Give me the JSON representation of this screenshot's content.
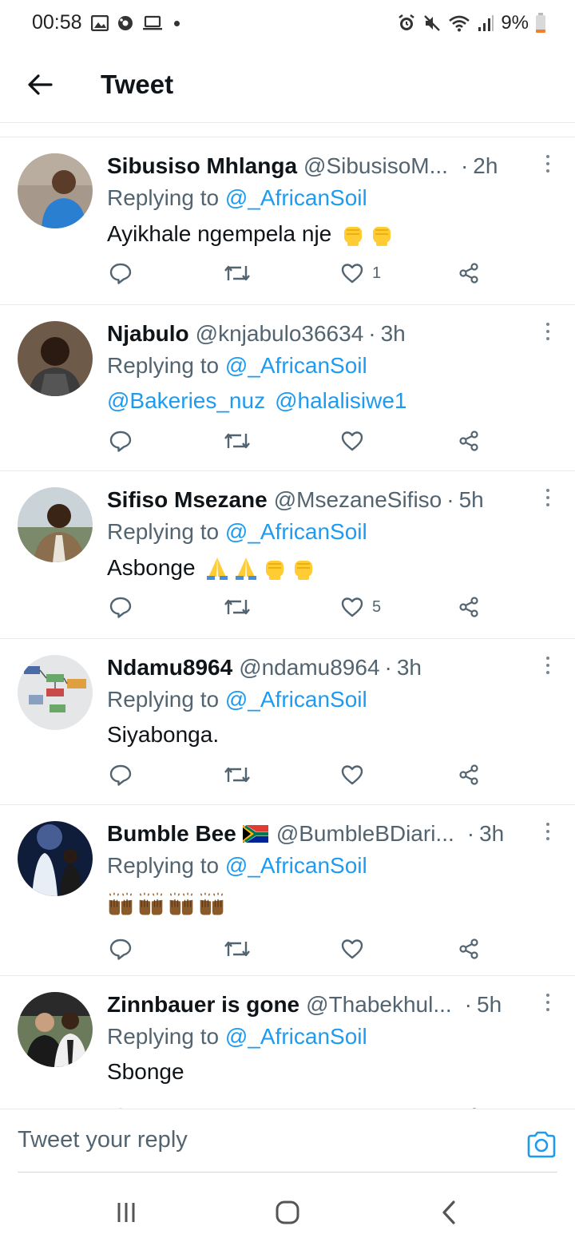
{
  "status_bar": {
    "time": "00:58",
    "battery_percent": "9%"
  },
  "header": {
    "title": "Tweet"
  },
  "replying_label": "Replying to",
  "replying_target": "@_AfricanSoil",
  "tweets": [
    {
      "name": "Sibusiso Mhlanga",
      "handle": "@SibusisoM...",
      "sep": "·",
      "time": "2h",
      "text": "Ayikhale ngempela nje",
      "emoji": [
        "raised-fist",
        "raised-fist"
      ],
      "likes": "1",
      "avatar_color": "#9c8f80"
    },
    {
      "name": "Njabulo",
      "handle": "@knjabulo36634",
      "sep": "·",
      "time": "3h",
      "mentions": [
        "@Bakeries_nuz",
        "@halalisiwe1"
      ],
      "likes": "",
      "avatar_color": "#5c4a3c"
    },
    {
      "name": "Sifiso Msezane",
      "handle": "@MsezaneSifiso",
      "sep": "·",
      "time": "5h",
      "text": "Asbonge",
      "emoji": [
        "folded-hands",
        "folded-hands",
        "raised-fist",
        "raised-fist"
      ],
      "likes": "5",
      "avatar_color": "#7a6c5b"
    },
    {
      "name": "Ndamu8964",
      "handle": "@ndamu8964",
      "sep": "·",
      "time": "3h",
      "text": "Siyabonga.",
      "likes": "",
      "avatar_color": "#c9cdd1"
    },
    {
      "name": "Bumble Bee",
      "handle": "@BumbleBDiari...",
      "sep": "·",
      "time": "3h",
      "emoji": [
        "raising-hands",
        "raising-hands",
        "raising-hands",
        "raising-hands"
      ],
      "likes": "",
      "avatar_color": "#1a2a4a"
    },
    {
      "name": "Zinnbauer is gone",
      "handle": "@Thabekhul...",
      "sep": "·",
      "time": "5h",
      "text": "Sbonge",
      "likes": "",
      "avatar_color": "#3a3a3a"
    }
  ],
  "composer": {
    "placeholder": "Tweet your reply"
  },
  "colors": {
    "link": "#1d9bf0",
    "secondary_text": "#536471",
    "primary_text": "#0f1419",
    "divider": "#e6ecf0"
  }
}
